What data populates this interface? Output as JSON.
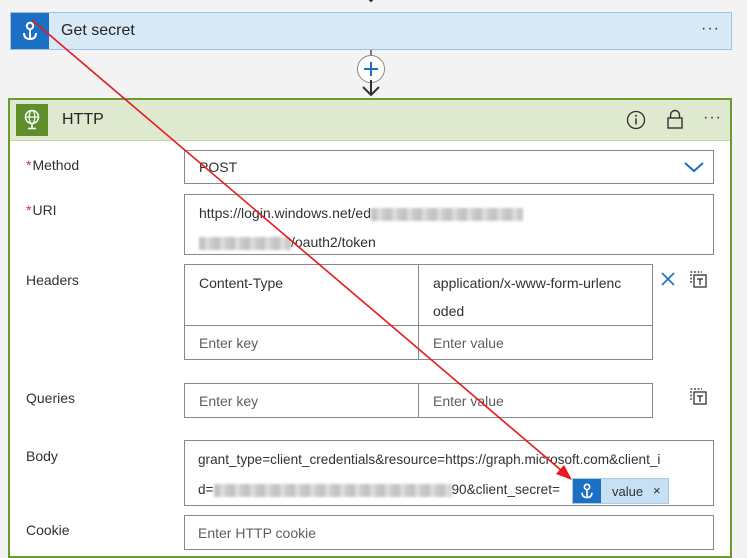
{
  "get_secret": {
    "title": "Get secret",
    "more": "···"
  },
  "http": {
    "title": "HTTP",
    "more": "···",
    "method": {
      "label": "Method",
      "required_mark": "*",
      "value": "POST"
    },
    "uri": {
      "label": "URI",
      "required_mark": "*",
      "line1_prefix": "https://login.windows.net/ed",
      "line2_suffix": "/oauth2/token"
    },
    "headers": {
      "label": "Headers",
      "rows": [
        {
          "key": "Content-Type",
          "value_line1": "application/x-www-form-urlenc",
          "value_line2": "oded"
        }
      ],
      "key_placeholder": "Enter key",
      "value_placeholder": "Enter value"
    },
    "queries": {
      "label": "Queries",
      "key_placeholder": "Enter key",
      "value_placeholder": "Enter value"
    },
    "body": {
      "label": "Body",
      "line1": "grant_type=client_credentials&resource=https://graph.microsoft.com&client_i",
      "line2_prefix": "d=",
      "line2_mid": "90&client_secret=",
      "token_label": "value",
      "token_remove": "×"
    },
    "cookie": {
      "label": "Cookie",
      "placeholder": "Enter HTTP cookie"
    }
  },
  "colors": {
    "accent_blue": "#1b6fc5",
    "http_green": "#5f8f2b",
    "required_red": "#d13438",
    "annotation_red": "#e8191c"
  }
}
